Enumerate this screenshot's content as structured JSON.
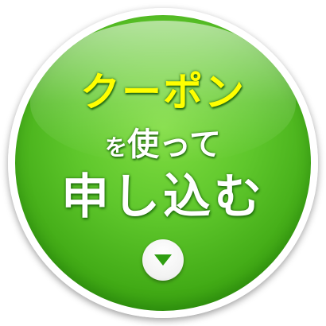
{
  "button": {
    "headline": "クーポン",
    "particle": "を",
    "verb": "使って",
    "action": "申し込む"
  },
  "icons": {
    "arrow": "chevron-down-icon"
  },
  "colors": {
    "button_green": "#4cb41c",
    "headline_yellow": "#ffff00",
    "text_white": "#ffffff",
    "arrow_green": "#2f9e12"
  }
}
